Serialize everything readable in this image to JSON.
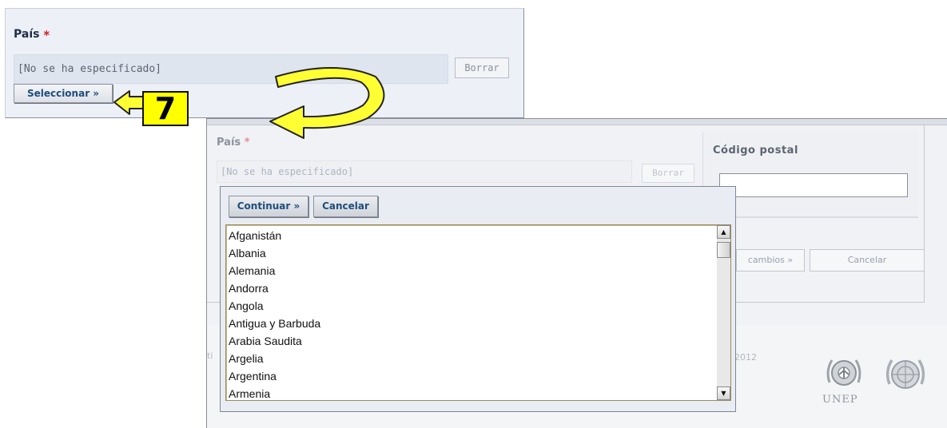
{
  "panel1": {
    "label": "País",
    "required_marker": "*",
    "value": "[No se ha especificado]",
    "clear_button": "Borrar",
    "select_button": "Seleccionar »"
  },
  "annotation": {
    "step": "7"
  },
  "panel2": {
    "label": "País",
    "required_marker": "*",
    "value": "[No se ha especificado]",
    "clear_button": "Borrar",
    "zip_label": "Código postal",
    "zip_value": "",
    "save_button": "cambios »",
    "cancel_button": "Cancelar",
    "year_text": "2012",
    "left_fragment": "ti",
    "logo_text": "UNEP"
  },
  "picker": {
    "continue_button": "Continuar »",
    "cancel_button": "Cancelar",
    "countries": [
      "Afganistán",
      "Albania",
      "Alemania",
      "Andorra",
      "Angola",
      "Antigua y Barbuda",
      "Arabia Saudita",
      "Argelia",
      "Argentina",
      "Armenia"
    ]
  },
  "colors": {
    "annotation_yellow": "#ffff00",
    "required_red": "#cc2222",
    "button_text_blue": "#1d4d7c"
  },
  "icons": [
    "arrow-annotation-icon",
    "unep-logo-icon",
    "un-emblem-icon",
    "scroll-up-icon",
    "scroll-down-icon"
  ]
}
